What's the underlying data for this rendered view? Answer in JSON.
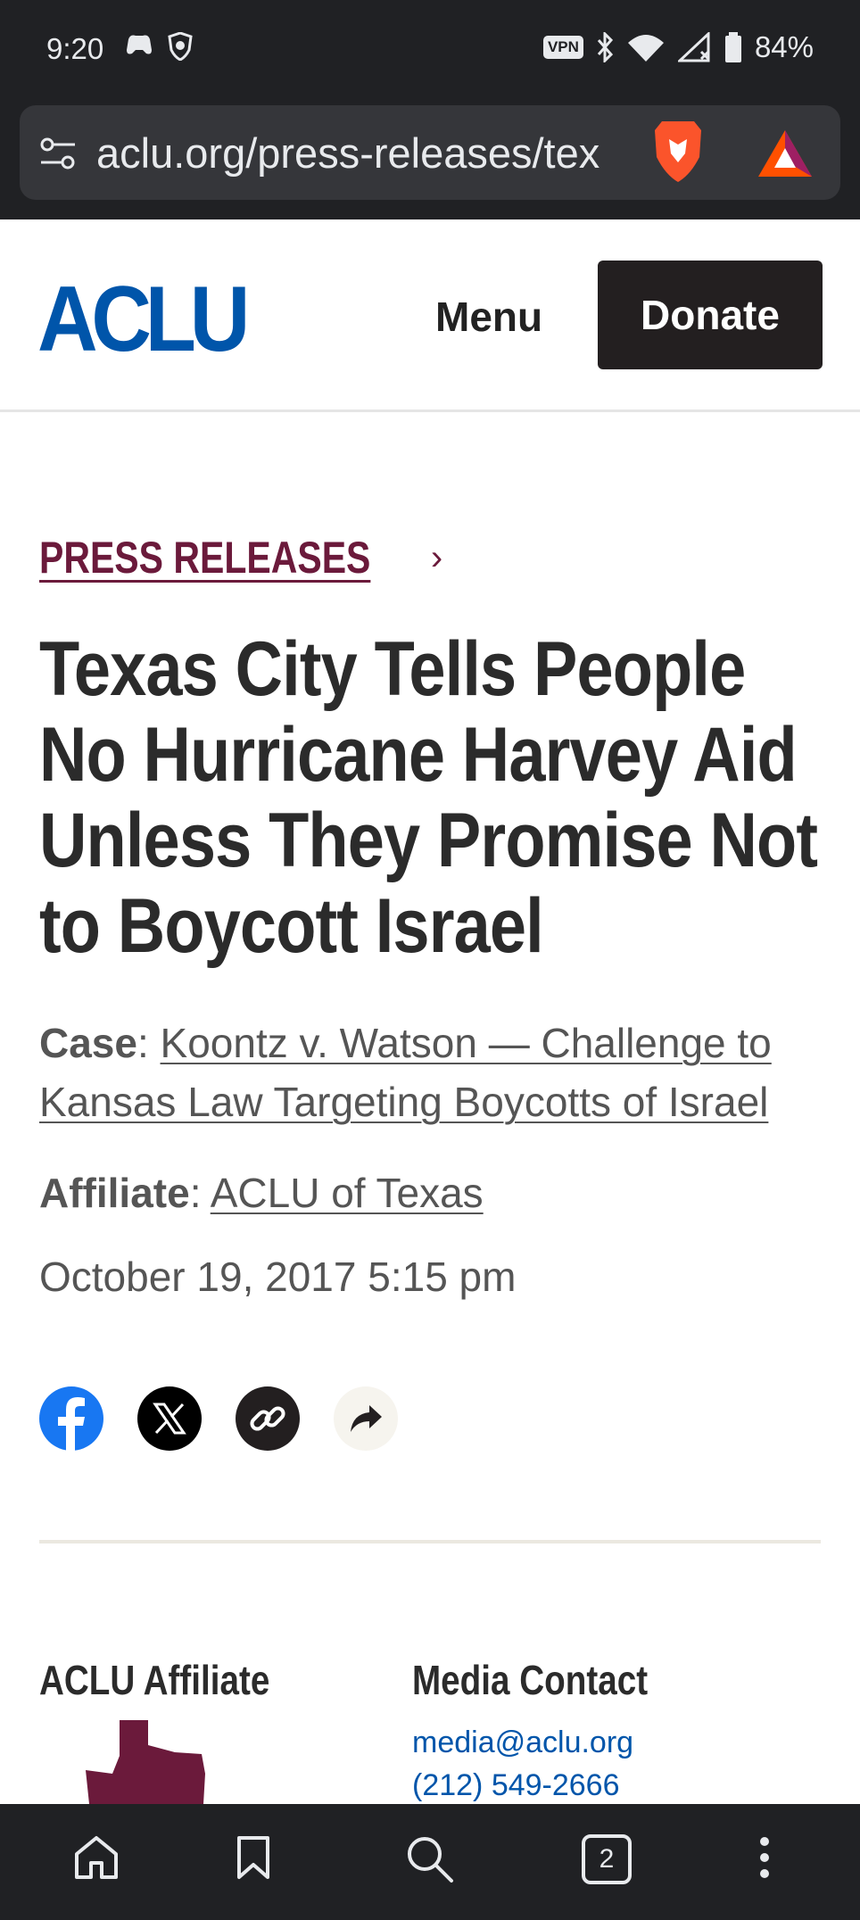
{
  "status_bar": {
    "time": "9:20",
    "vpn": "VPN",
    "battery": "84%",
    "icons_left": [
      "game-controller-icon",
      "shield-icon"
    ],
    "icons_right": [
      "vpn-icon",
      "bluetooth-icon",
      "wifi-icon",
      "signal-icon",
      "battery-icon"
    ]
  },
  "browser": {
    "url": "aclu.org/press-releases/tex"
  },
  "header": {
    "logo": "ACLU",
    "menu_label": "Menu",
    "donate_label": "Donate"
  },
  "article": {
    "breadcrumb": "PRESS RELEASES",
    "breadcrumb_chevron": "›",
    "title": "Texas City Tells People No Hurricane Harvey Aid Unless They Promise Not to Boycott Israel",
    "case_label": "Case",
    "case_link": "Koontz v. Watson — Challenge to Kansas Law Targeting Boycotts of Israel",
    "affiliate_label": "Affiliate",
    "affiliate_link": "ACLU of Texas",
    "date": "October 19, 2017 5:15 pm"
  },
  "share": [
    "facebook-icon",
    "x-icon",
    "link-icon",
    "share-arrow-icon"
  ],
  "footer_sections": {
    "affiliate_heading": "ACLU Affiliate",
    "media_heading": "Media Contact",
    "email": "media@aclu.org",
    "phone": "(212) 549-2666"
  },
  "bottom_nav": {
    "tab_count": "2",
    "items": [
      "home-icon",
      "bookmark-icon",
      "search-icon",
      "tabs-icon",
      "more-icon"
    ]
  },
  "colors": {
    "aclu_blue": "#0055aa",
    "maroon": "#6b1a3b",
    "dark": "#231f20"
  }
}
